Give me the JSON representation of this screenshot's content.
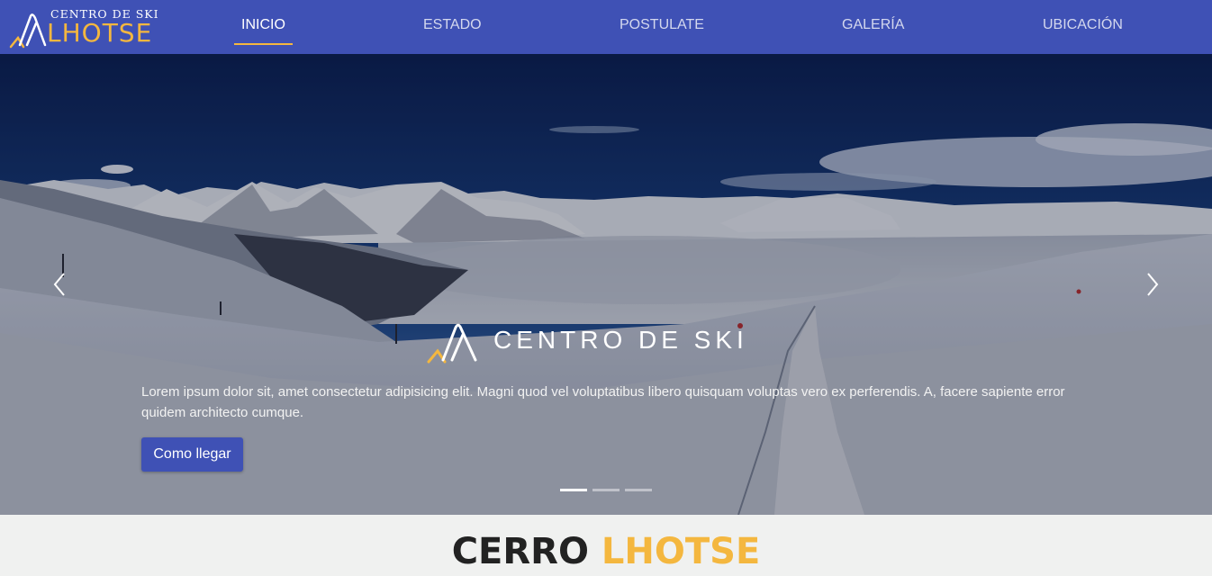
{
  "nav": {
    "brand_top": "CENTRO DE SKI",
    "brand_main": "LHOTSE",
    "items": [
      {
        "label": "INICIO",
        "active": true
      },
      {
        "label": "ESTADO",
        "active": false
      },
      {
        "label": "POSTULATE",
        "active": false
      },
      {
        "label": "GALERÍA",
        "active": false
      },
      {
        "label": "UBICACIÓN",
        "active": false
      }
    ]
  },
  "hero": {
    "caption_title": "CENTRO DE SKI",
    "caption_text": "Lorem ipsum dolor sit, amet consectetur adipisicing elit. Magni quod vel voluptatibus libero quisquam voluptas vero ex perferendis. A, facere sapiente error quidem architecto cumque.",
    "cta_label": "Como llegar",
    "slide_count": 3,
    "active_slide": 1
  },
  "section": {
    "title_part1": "CERRO",
    "title_part2": "LHOTSE"
  },
  "colors": {
    "nav_bg": "#3f51b5",
    "accent": "#f4b73f",
    "button": "#3f51b5",
    "page_bg": "#f0f1f0"
  }
}
